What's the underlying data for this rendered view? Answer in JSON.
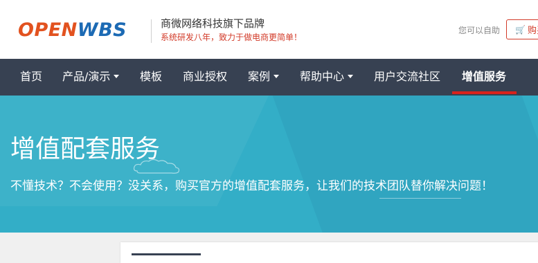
{
  "brand": {
    "logo_part1": "OPEN",
    "logo_part2": "WBS",
    "tagline": "商微网络科技旗下品牌",
    "slogan": "系统研发八年，致力于做电商更简单！"
  },
  "header_right": {
    "help_text": "您可以自助",
    "buy_label": "购买"
  },
  "nav": {
    "items": [
      {
        "label": "首页",
        "dropdown": false
      },
      {
        "label": "产品/演示",
        "dropdown": true
      },
      {
        "label": "模板",
        "dropdown": false
      },
      {
        "label": "商业授权",
        "dropdown": false
      },
      {
        "label": "案例",
        "dropdown": true
      },
      {
        "label": "帮助中心",
        "dropdown": true
      },
      {
        "label": "用户交流社区",
        "dropdown": false
      },
      {
        "label": "增值服务",
        "dropdown": false,
        "active": true
      }
    ]
  },
  "banner": {
    "title": "增值配套服务",
    "subtitle": "不懂技术？不会使用？没关系，购买官方的增值配套服务，让我们的技术团队替你解决问题！"
  },
  "colors": {
    "nav_bg": "#374152",
    "banner_bg": "#33aec7",
    "accent_red": "#d9221c",
    "logo_orange": "#e2521f",
    "logo_blue": "#1c6ab4"
  }
}
